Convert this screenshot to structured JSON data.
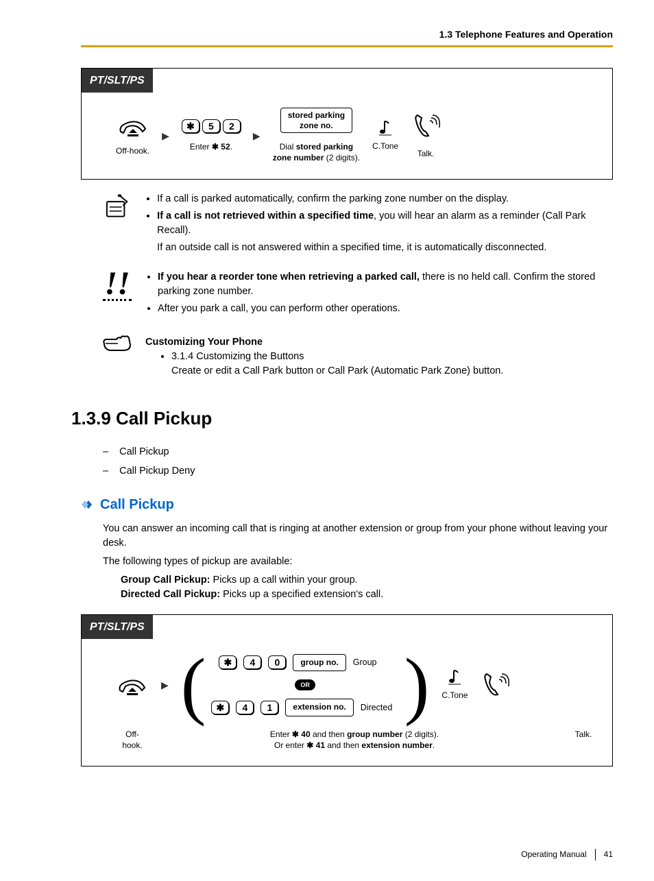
{
  "header": "1.3 Telephone Features and Operation",
  "box1": {
    "title": "PT/SLT/PS",
    "offhook": "Off-hook.",
    "keys1": [
      "✱",
      "5",
      "2"
    ],
    "enter_caption_prefix": "Enter ",
    "enter_caption_code": "✱ 52",
    "stored_box_line1": "stored parking",
    "stored_box_line2": "zone no.",
    "dial_caption_prefix": "Dial ",
    "dial_caption_bold": "stored parking",
    "dial_caption_line2a": "zone number",
    "dial_caption_line2b": " (2 digits).",
    "ctone": "C.Tone",
    "talk": "Talk."
  },
  "notes1": [
    "If a call is parked automatically, confirm the parking zone number on the display.",
    "If a call is not retrieved within a specified time, you will hear an alarm as a reminder (Call Park Recall)."
  ],
  "notes1_bold": "If a call is not retrieved within a specified time",
  "notes1_rest": ", you will hear an alarm as a reminder (Call Park Recall).",
  "notes1_extra": "If an outside call is not answered within a specified time, it is automatically disconnected.",
  "notes2_bold": "If you hear a reorder tone when retrieving a parked call,",
  "notes2_rest": " there is no held call. Confirm the stored parking zone number.",
  "notes2_b": "After you park a call, you can perform other operations.",
  "cust_title": "Customizing Your Phone",
  "cust_item": "3.1.4 Customizing the Buttons",
  "cust_desc": "Create or edit a Call Park button or Call Park (Automatic Park Zone) button.",
  "section_title": "1.3.9    Call Pickup",
  "dashlist": [
    "Call Pickup",
    "Call Pickup Deny"
  ],
  "subsection_title": "Call Pickup",
  "body1": "You can answer an incoming call that is ringing at another extension or group from your phone without leaving your desk.",
  "body2": "The following types of pickup are available:",
  "group_label": "Group Call Pickup:",
  "group_desc": " Picks up a call within your group.",
  "dir_label": "Directed Call Pickup:",
  "dir_desc": " Picks up a specified extension's call.",
  "box2": {
    "title": "PT/SLT/PS",
    "offhook": "Off-hook.",
    "row1_keys": [
      "✱",
      "4",
      "0"
    ],
    "row1_box": "group no.",
    "row1_label": "Group",
    "or": "OR",
    "row2_keys": [
      "✱",
      "4",
      "1"
    ],
    "row2_box": "extension no.",
    "row2_label": "Directed",
    "ctone": "C.Tone",
    "talk": "Talk.",
    "cap1_pre": "Enter ",
    "cap1_code": "✱ 40",
    "cap1_mid": " and then ",
    "cap1_bold": "group number",
    "cap1_end": " (2 digits).",
    "cap2_pre": "Or enter ",
    "cap2_code": "✱ 41",
    "cap2_mid": " and then ",
    "cap2_bold": "extension number",
    "cap2_end": "."
  },
  "footer_text": "Operating Manual",
  "page_no": "41"
}
